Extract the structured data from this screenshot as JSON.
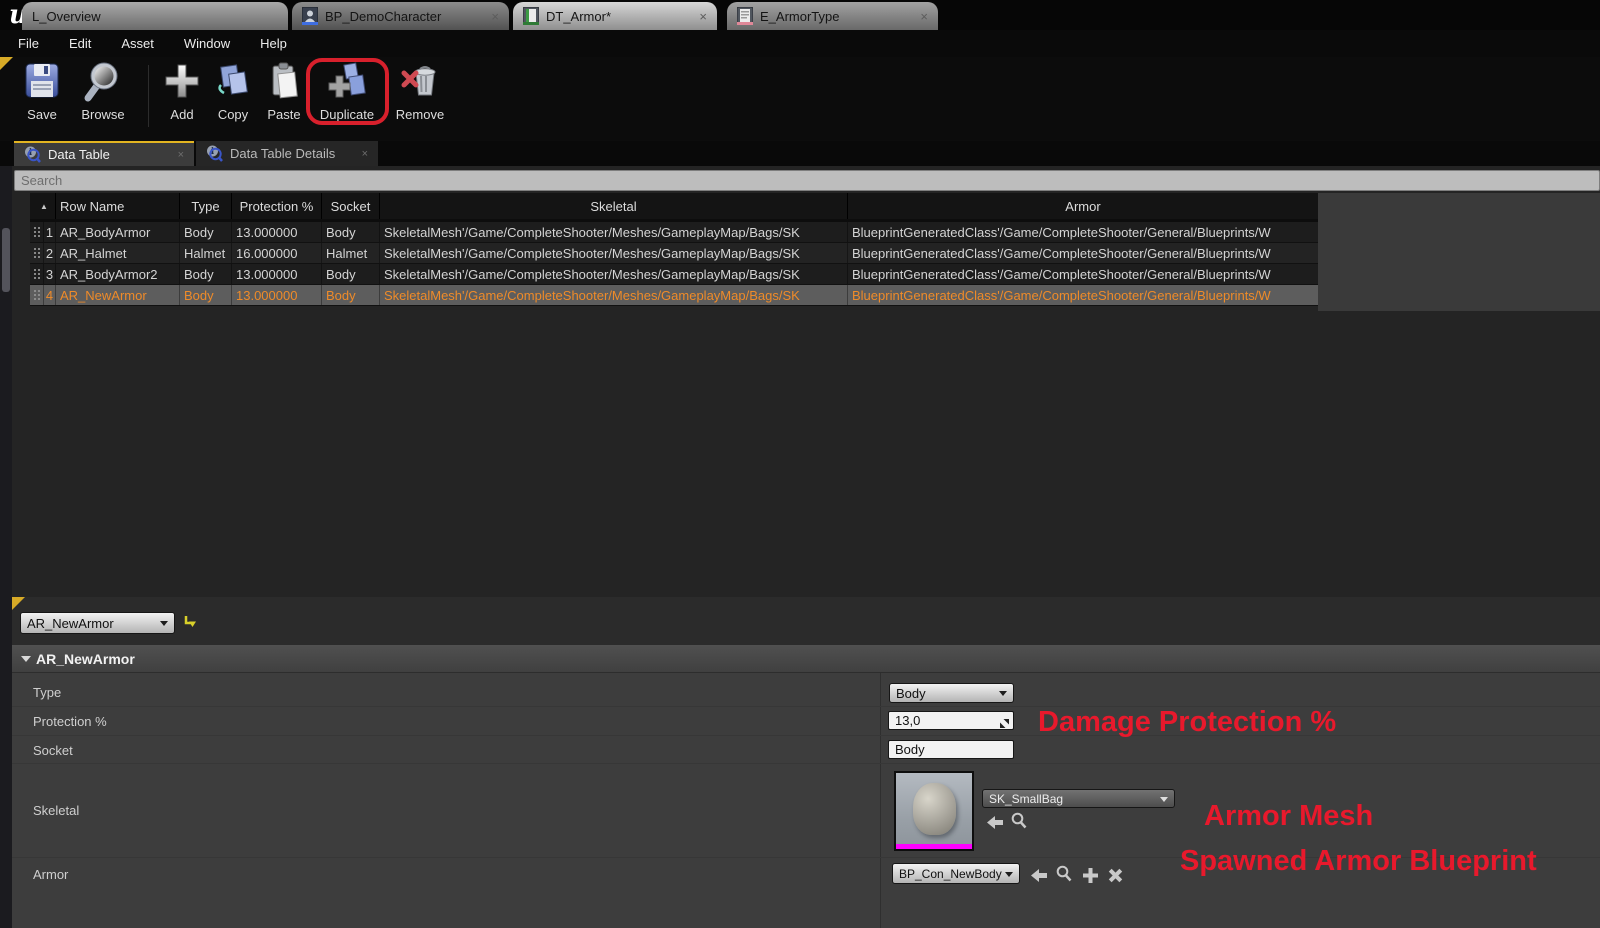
{
  "titlebar": {
    "logo": "u",
    "tabs": [
      {
        "label": "L_Overview"
      },
      {
        "label": "BP_DemoCharacter",
        "close": "×"
      },
      {
        "label": "DT_Armor*",
        "close": "×"
      },
      {
        "label": "E_ArmorType",
        "close": "×"
      }
    ]
  },
  "menubar": {
    "items": [
      "File",
      "Edit",
      "Asset",
      "Window",
      "Help"
    ]
  },
  "toolbar": {
    "save": "Save",
    "browse": "Browse",
    "add": "Add",
    "copy": "Copy",
    "paste": "Paste",
    "duplicate": "Duplicate",
    "remove": "Remove"
  },
  "panel_tabs": {
    "data_table": "Data Table",
    "data_table_details": "Data Table Details",
    "close": "×"
  },
  "search": {
    "placeholder": "Search"
  },
  "table": {
    "sort_icon": "▲",
    "headers": {
      "row_name": "Row Name",
      "type": "Type",
      "protection": "Protection %",
      "socket": "Socket",
      "skeletal": "Skeletal",
      "armor": "Armor"
    },
    "rows": [
      {
        "num": "1",
        "name": "AR_BodyArmor",
        "type": "Body",
        "protection": "13.000000",
        "socket": "Body",
        "skeletal": "SkeletalMesh'/Game/CompleteShooter/Meshes/GameplayMap/Bags/SK",
        "armor": "BlueprintGeneratedClass'/Game/CompleteShooter/General/Blueprints/W"
      },
      {
        "num": "2",
        "name": "AR_Halmet",
        "type": "Halmet",
        "protection": "16.000000",
        "socket": "Halmet",
        "skeletal": "SkeletalMesh'/Game/CompleteShooter/Meshes/GameplayMap/Bags/SK",
        "armor": "BlueprintGeneratedClass'/Game/CompleteShooter/General/Blueprints/W"
      },
      {
        "num": "3",
        "name": "AR_BodyArmor2",
        "type": "Body",
        "protection": "13.000000",
        "socket": "Body",
        "skeletal": "SkeletalMesh'/Game/CompleteShooter/Meshes/GameplayMap/Bags/SK",
        "armor": "BlueprintGeneratedClass'/Game/CompleteShooter/General/Blueprints/W"
      },
      {
        "num": "4",
        "name": "AR_NewArmor",
        "type": "Body",
        "protection": "13.000000",
        "socket": "Body",
        "skeletal": "SkeletalMesh'/Game/CompleteShooter/Meshes/GameplayMap/Bags/SK",
        "armor": "BlueprintGeneratedClass'/Game/CompleteShooter/General/Blueprints/W"
      }
    ]
  },
  "details": {
    "row_selector_value": "AR_NewArmor",
    "section_title": "AR_NewArmor",
    "labels": {
      "type": "Type",
      "protection": "Protection %",
      "socket": "Socket",
      "skeletal": "Skeletal",
      "armor": "Armor"
    },
    "type_value": "Body",
    "protection_value": "13,0",
    "socket_value": "Body",
    "skeletal_value": "SK_SmallBag",
    "armor_value": "BP_Con_NewBody"
  },
  "annotations": {
    "protection": "Damage Protection %",
    "mesh": "Armor Mesh",
    "blueprint": "Spawned Armor Blueprint",
    "color": "#e8192c"
  },
  "colors": {
    "highlight_box_red": "#d8202c",
    "selected_row_bg": "#5d5d5d",
    "selected_row_text": "#ef8b29",
    "active_tab_accent": "#e3b521",
    "thumbnail_selected_bar": "#ff00ff"
  }
}
